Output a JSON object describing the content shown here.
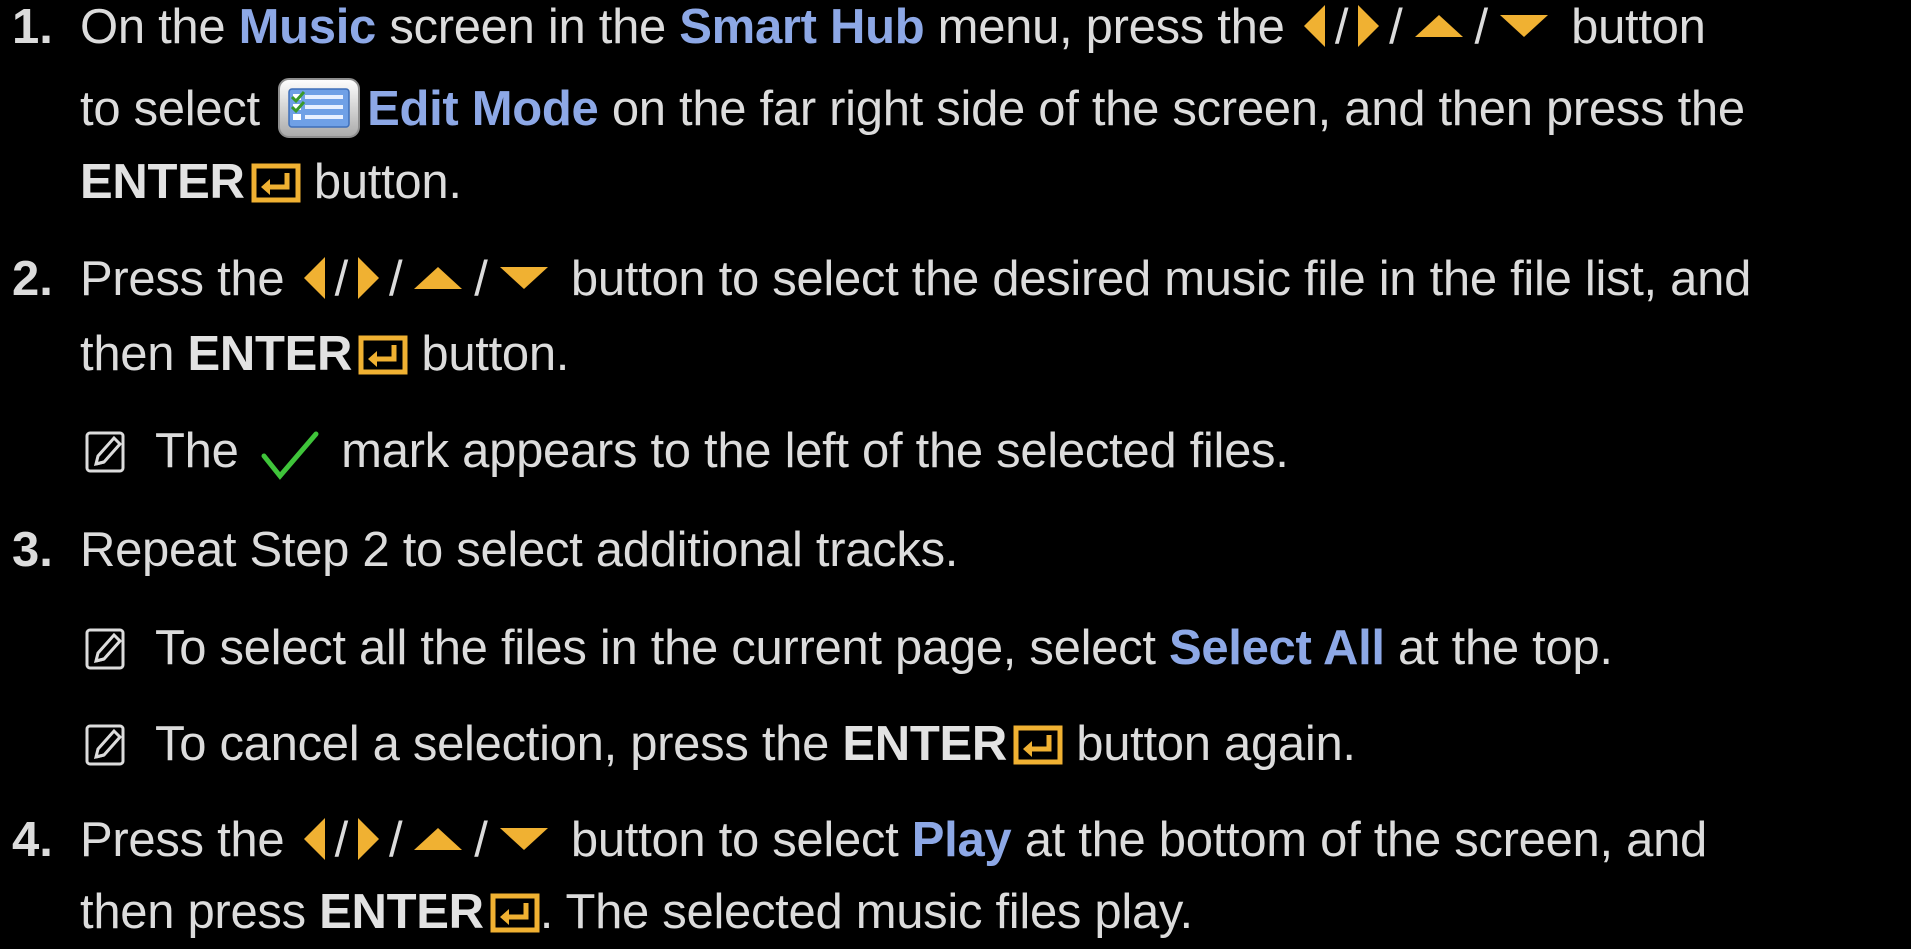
{
  "steps": [
    {
      "number": "1.",
      "line1": {
        "t1": "On the ",
        "music": "Music",
        "t2": " screen in the ",
        "smart_hub": "Smart Hub",
        "t3": " menu, press the ",
        "sep1": "/",
        "sep2": "/",
        "sep3": "/",
        "t4": " button"
      },
      "line2": {
        "t1": "to select ",
        "edit_mode": "Edit Mode",
        "t2": " on the far right side of the screen, and then press the"
      },
      "line3": {
        "enter": "ENTER",
        "t1": " button."
      }
    },
    {
      "number": "2.",
      "line1": {
        "t1": "Press the ",
        "sep1": "/",
        "sep2": "/",
        "sep3": "/",
        "t2": " button to select the desired music file in the file list, and"
      },
      "line2": {
        "t1": "then ",
        "enter": "ENTER",
        "t2": " button."
      },
      "note": {
        "t1": "The ",
        "t2": " mark appears to the left of the selected files."
      }
    },
    {
      "number": "3.",
      "line1": "Repeat Step 2 to select additional tracks.",
      "note1": {
        "t1": "To select all the files in the current page, select ",
        "select_all": "Select All",
        "t2": " at the top."
      },
      "note2": {
        "t1": "To cancel a selection, press the ",
        "enter": "ENTER",
        "t2": " button again."
      }
    },
    {
      "number": "4.",
      "line1": {
        "t1": "Press the ",
        "sep1": "/",
        "sep2": "/",
        "sep3": "/",
        "t2": " button to select ",
        "play": "Play",
        "t3": " at the bottom of the screen, and"
      },
      "line2": {
        "t1": "then press ",
        "enter": "ENTER",
        "t2": ". The selected music files play."
      }
    }
  ],
  "icons": {
    "arrow_color": "#f0b132",
    "highlight_color": "#8da8e6",
    "check_color": "#3fc43a",
    "left": "left-arrow-icon",
    "right": "right-arrow-icon",
    "up": "up-arrow-icon",
    "down": "down-arrow-icon",
    "enter": "enter-icon",
    "edit_mode": "edit-mode-icon",
    "check": "checkmark-icon",
    "note": "note-icon"
  }
}
